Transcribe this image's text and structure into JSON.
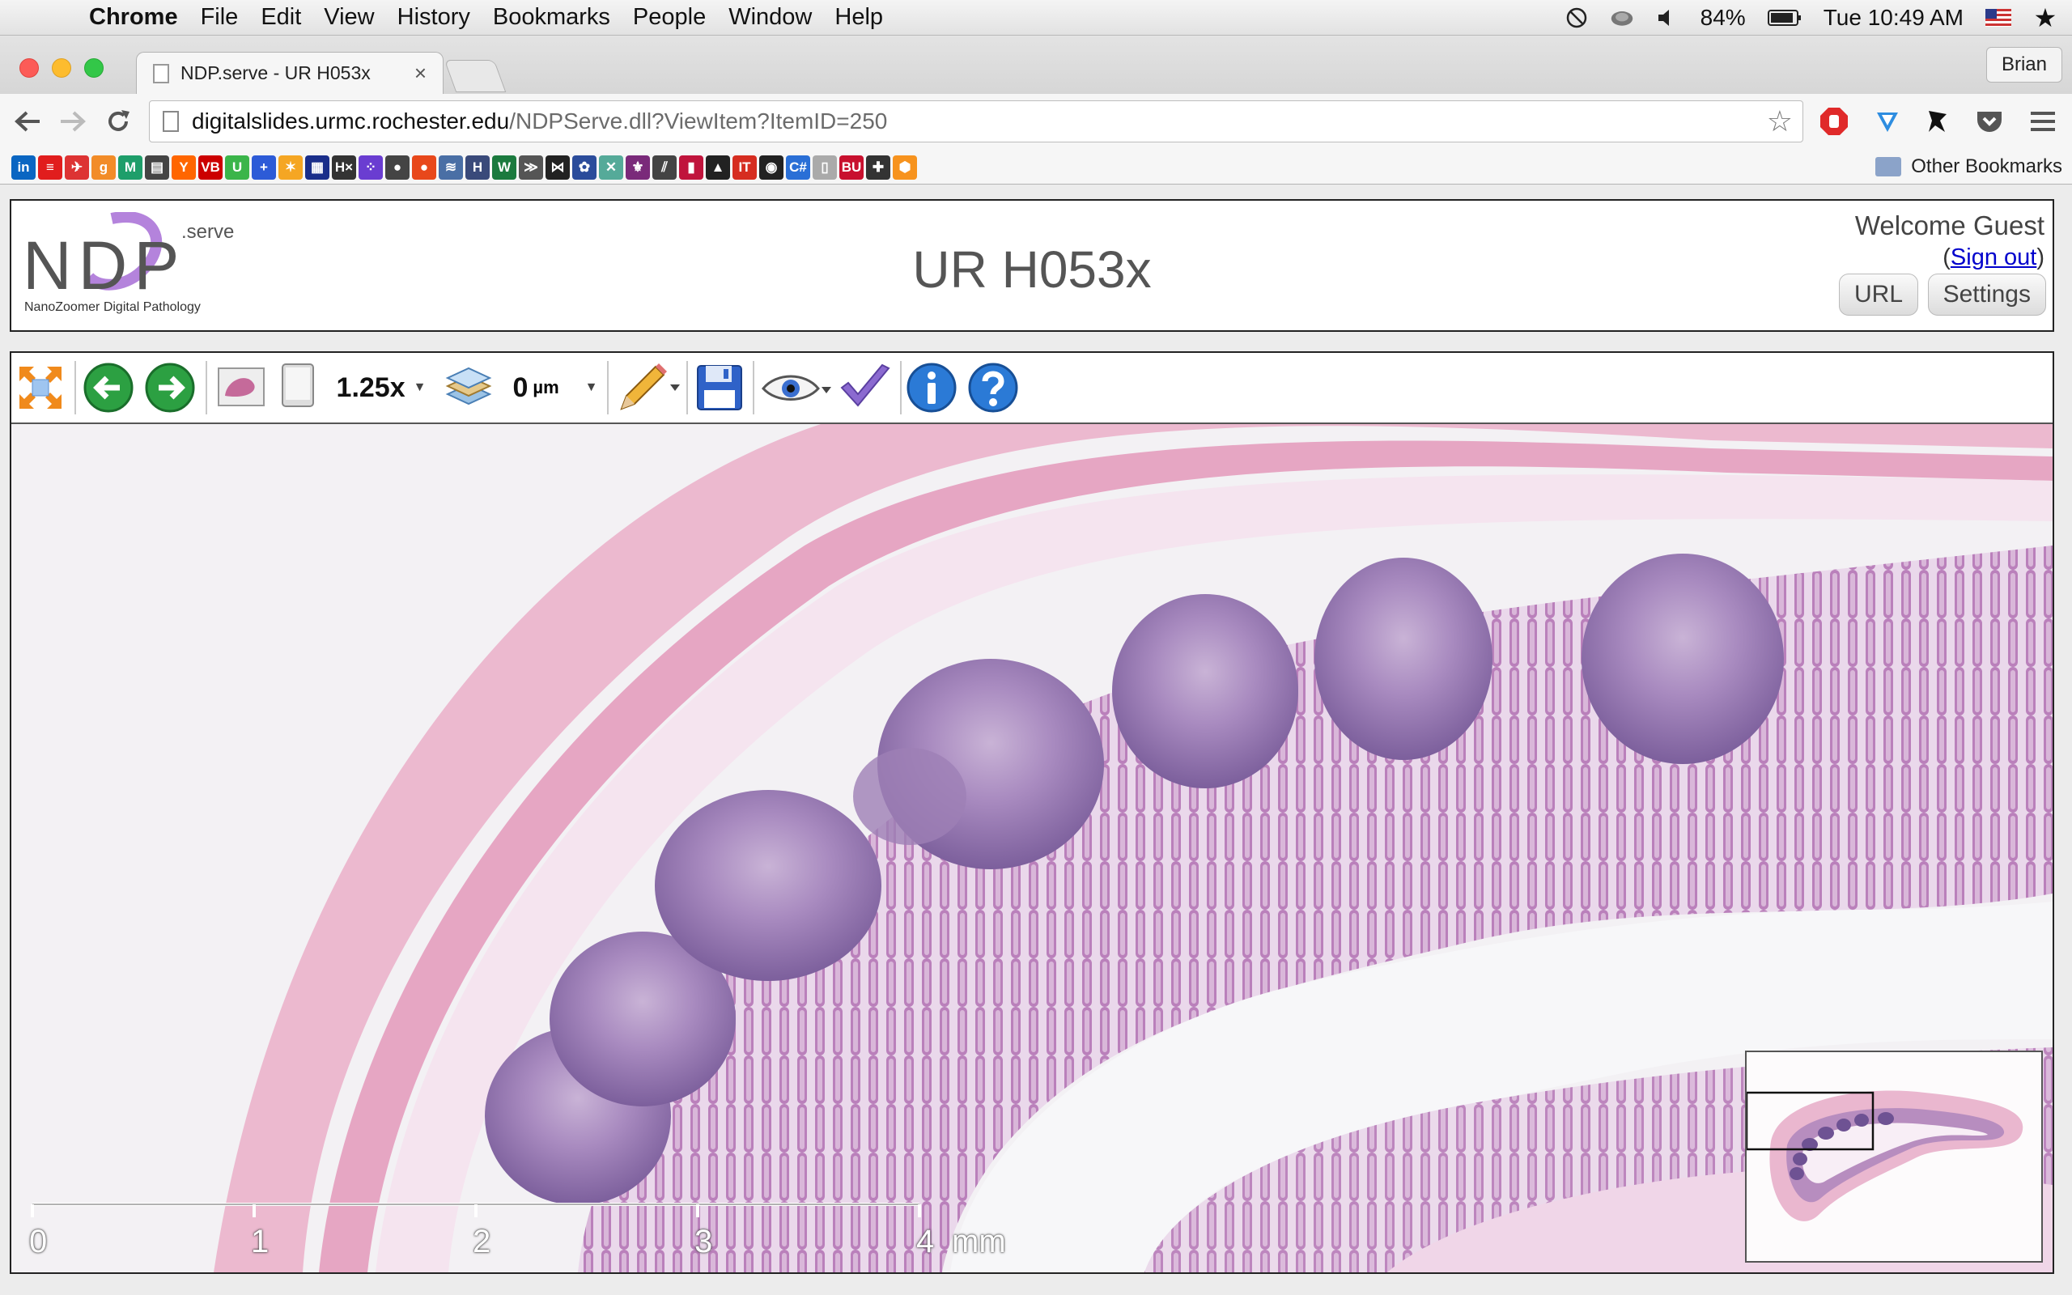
{
  "menubar": {
    "app": "Chrome",
    "items": [
      "File",
      "Edit",
      "View",
      "History",
      "Bookmarks",
      "People",
      "Window",
      "Help"
    ],
    "battery": "84%",
    "clock": "Tue 10:49 AM"
  },
  "browser": {
    "tab_title": "NDP.serve - UR H053x",
    "tab_close": "×",
    "profile": "Brian",
    "url_host": "digitalslides.urmc.rochester.edu",
    "url_path": "/NDPServe.dll?ViewItem?ItemID=250",
    "other_bookmarks": "Other Bookmarks",
    "bookmarks": [
      {
        "label": "in",
        "color": "#0a66c2"
      },
      {
        "label": "≡",
        "color": "#e11d1d"
      },
      {
        "label": "✈",
        "color": "#d33"
      },
      {
        "label": "g",
        "color": "#f28c28"
      },
      {
        "label": "M",
        "color": "#1e9e6a"
      },
      {
        "label": "▤",
        "color": "#444"
      },
      {
        "label": "Y",
        "color": "#ff6600"
      },
      {
        "label": "VB",
        "color": "#c00"
      },
      {
        "label": "U",
        "color": "#3bb54a"
      },
      {
        "label": "+",
        "color": "#2d5bd7"
      },
      {
        "label": "✶",
        "color": "#f5a623"
      },
      {
        "label": "▦",
        "color": "#1a2e8a"
      },
      {
        "label": "H×",
        "color": "#333"
      },
      {
        "label": "⁘",
        "color": "#6a3dd1"
      },
      {
        "label": "●",
        "color": "#444"
      },
      {
        "label": "●",
        "color": "#e8481b"
      },
      {
        "label": "≋",
        "color": "#4a6fa5"
      },
      {
        "label": "H",
        "color": "#3a4a7a"
      },
      {
        "label": "W",
        "color": "#1b7a3e"
      },
      {
        "label": "≫",
        "color": "#555"
      },
      {
        "label": "⋈",
        "color": "#222"
      },
      {
        "label": "✿",
        "color": "#2b4c9b"
      },
      {
        "label": "✕",
        "color": "#5a9"
      },
      {
        "label": "⚜",
        "color": "#7a2a7a"
      },
      {
        "label": "⫽",
        "color": "#444"
      },
      {
        "label": "▮",
        "color": "#c0143c"
      },
      {
        "label": "▲",
        "color": "#222"
      },
      {
        "label": "IT",
        "color": "#d62d20"
      },
      {
        "label": "◉",
        "color": "#222"
      },
      {
        "label": "C#",
        "color": "#2a6fd6"
      },
      {
        "label": "▯",
        "color": "#aaa"
      },
      {
        "label": "BU",
        "color": "#c8102e"
      },
      {
        "label": "✚",
        "color": "#333"
      },
      {
        "label": "⬢",
        "color": "#f7931e"
      }
    ]
  },
  "ndp": {
    "logo_text": "NDP",
    "logo_serve": ".serve",
    "logo_tagline": "NanoZoomer Digital Pathology",
    "title": "UR H053x",
    "welcome": "Welcome Guest",
    "signout_open": "(",
    "signout_link": "Sign out",
    "signout_close": ")",
    "url_btn": "URL",
    "settings_btn": "Settings"
  },
  "viewer": {
    "zoom": "1.25x",
    "focus": "0",
    "focus_unit": "µm",
    "scale_labels": [
      "0",
      "1",
      "2",
      "3",
      "4"
    ],
    "scale_unit": "mm"
  }
}
